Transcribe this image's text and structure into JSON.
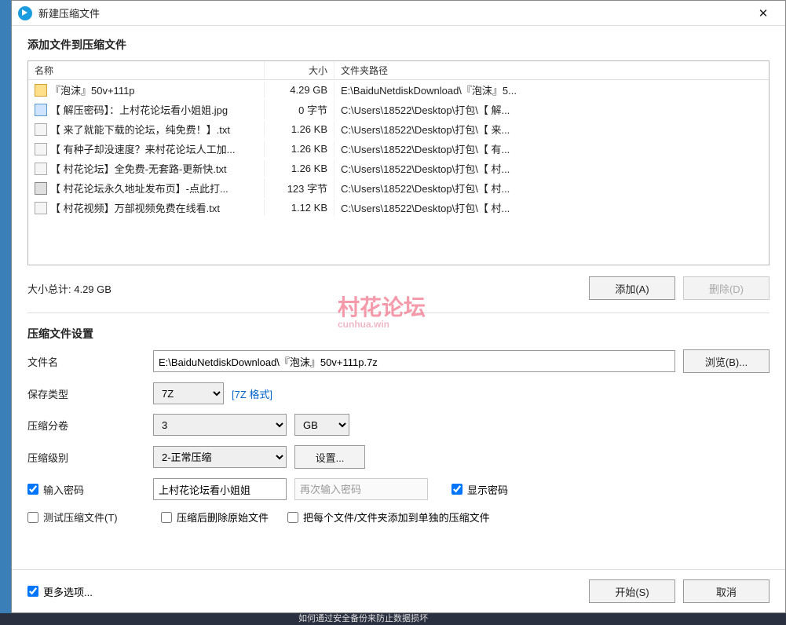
{
  "titlebar": {
    "title": "新建压缩文件"
  },
  "section_add": {
    "title": "添加文件到压缩文件"
  },
  "columns": {
    "name": "名称",
    "size": "大小",
    "path": "文件夹路径"
  },
  "files": [
    {
      "icon": "folder",
      "name": "『泡沫』50v+111p",
      "size": "4.29 GB",
      "path": "E:\\BaiduNetdiskDownload\\『泡沫』5..."
    },
    {
      "icon": "jpg",
      "name": "【 解压密码】：上村花论坛看小姐姐.jpg",
      "size": "0 字节",
      "path": "C:\\Users\\18522\\Desktop\\打包\\【 解..."
    },
    {
      "icon": "txt",
      "name": "【 来了就能下载的论坛，纯免费！】.txt",
      "size": "1.26 KB",
      "path": "C:\\Users\\18522\\Desktop\\打包\\【 来..."
    },
    {
      "icon": "txt",
      "name": "【 有种子却没速度？来村花论坛人工加...",
      "size": "1.26 KB",
      "path": "C:\\Users\\18522\\Desktop\\打包\\【 有..."
    },
    {
      "icon": "txt",
      "name": "【 村花论坛】全免费-无套路-更新快.txt",
      "size": "1.26 KB",
      "path": "C:\\Users\\18522\\Desktop\\打包\\【 村..."
    },
    {
      "icon": "url",
      "name": "【 村花论坛永久地址发布页】-点此打...",
      "size": "123 字节",
      "path": "C:\\Users\\18522\\Desktop\\打包\\【 村..."
    },
    {
      "icon": "txt",
      "name": "【 村花视频】万部视频免费在线看.txt",
      "size": "1.12 KB",
      "path": "C:\\Users\\18522\\Desktop\\打包\\【 村..."
    }
  ],
  "total_label": "大小总计: 4.29 GB",
  "buttons": {
    "add": "添加(A)",
    "delete": "删除(D)",
    "browse": "浏览(B)...",
    "settings": "设置...",
    "start": "开始(S)",
    "cancel": "取消"
  },
  "settings": {
    "section_title": "压缩文件设置",
    "filename_label": "文件名",
    "filename_value": "E:\\BaiduNetdiskDownload\\『泡沫』50v+111p.7z",
    "savetype_label": "保存类型",
    "savetype_value": "7Z",
    "savetype_link": "[7Z 格式]",
    "split_label": "压缩分卷",
    "split_count": "3",
    "split_unit": "GB",
    "level_label": "压缩级别",
    "level_value": "2-正常压缩",
    "password_label": "输入密码",
    "password_value": "上村花论坛看小姐姐",
    "password_confirm_placeholder": "再次输入密码",
    "show_password_label": "显示密码",
    "test_label": "测试压缩文件(T)",
    "delete_after_label": "压缩后删除原始文件",
    "each_separate_label": "把每个文件/文件夹添加到单独的压缩文件"
  },
  "footer": {
    "more_label": "更多选项..."
  },
  "watermark": {
    "text": "村花论坛",
    "sub": "cunhua.win"
  },
  "bg_strip": "如何通过安全备份来防止数据损坏"
}
